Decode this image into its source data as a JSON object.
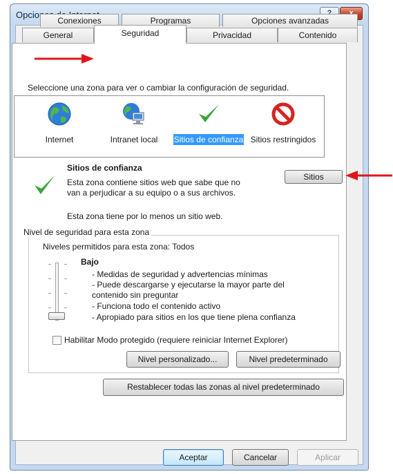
{
  "window": {
    "title": "Opciones de Internet",
    "help_glyph": "?",
    "close_glyph": "x"
  },
  "tabs": {
    "row1": [
      "Conexiones",
      "Programas",
      "Opciones avanzadas"
    ],
    "row2": [
      "General",
      "Seguridad",
      "Privacidad",
      "Contenido"
    ],
    "active": "Seguridad"
  },
  "zones": {
    "instruction": "Seleccione una zona para ver o cambiar la configuración de seguridad.",
    "items": [
      {
        "label": "Internet",
        "icon": "globe-icon",
        "selected": false
      },
      {
        "label": "Intranet local",
        "icon": "intranet-icon",
        "selected": false
      },
      {
        "label": "Sitios de confianza",
        "icon": "checkmark-icon",
        "selected": true
      },
      {
        "label": "Sitios restringidos",
        "icon": "restricted-icon",
        "selected": false
      }
    ]
  },
  "zone_info": {
    "title": "Sitios de confianza",
    "desc_line1": "Esta zona contiene sitios web que sabe que no",
    "desc_line2": "van a perjudicar a su equipo o a sus archivos.",
    "note": "Esta zona tiene por lo menos un sitio web.",
    "sites_button": "Sitios"
  },
  "security_level": {
    "group_title": "Nivel de seguridad para esta zona",
    "allowed": "Niveles permitidos para esta zona: Todos",
    "level_name": "Bajo",
    "bullets": [
      "- Medidas de seguridad y advertencias mínimas",
      "- Puede descargarse y ejecutarse la mayor parte del",
      "contenido sin preguntar",
      "- Funciona todo el contenido activo",
      "- Apropiado para sitios en los que tiene plena confianza"
    ],
    "protected_mode_label": "Habilitar Modo protegido (requiere reiniciar Internet Explorer)",
    "protected_mode_checked": false,
    "custom_button": "Nivel personalizado...",
    "default_button": "Nivel predeterminado"
  },
  "reset_all_button": "Restablecer todas las zonas al nivel predeterminado",
  "footer": {
    "ok": "Aceptar",
    "cancel": "Cancelar",
    "apply": "Aplicar"
  },
  "colors": {
    "selection": "#3399ff",
    "annotation_arrow": "#e0161b",
    "check_green": "#3aa53a",
    "restricted_red": "#d8231f"
  }
}
